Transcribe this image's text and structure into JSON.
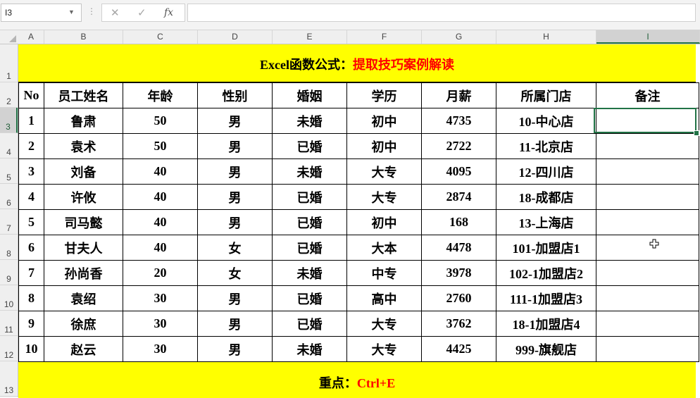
{
  "formula_bar": {
    "name_box": "I3",
    "formula": "",
    "cancel_icon": "✕",
    "enter_icon": "✓",
    "fx_label": "fx"
  },
  "columns": [
    "A",
    "B",
    "C",
    "D",
    "E",
    "F",
    "G",
    "H",
    "I"
  ],
  "selected_column": "I",
  "rows": [
    "1",
    "2",
    "3",
    "4",
    "5",
    "6",
    "7",
    "8",
    "9",
    "10",
    "11",
    "12",
    "13"
  ],
  "selected_row": "3",
  "title": {
    "prefix": "Excel函数公式：",
    "suffix": "提取技巧案例解读"
  },
  "table": {
    "headers": [
      "No",
      "员工姓名",
      "年龄",
      "性别",
      "婚姻",
      "学历",
      "月薪",
      "所属门店",
      "备注"
    ],
    "rows": [
      [
        "1",
        "鲁肃",
        "50",
        "男",
        "未婚",
        "初中",
        "4735",
        "10-中心店",
        ""
      ],
      [
        "2",
        "袁术",
        "50",
        "男",
        "已婚",
        "初中",
        "2722",
        "11-北京店",
        ""
      ],
      [
        "3",
        "刘备",
        "40",
        "男",
        "未婚",
        "大专",
        "4095",
        "12-四川店",
        ""
      ],
      [
        "4",
        "许攸",
        "40",
        "男",
        "已婚",
        "大专",
        "2874",
        "18-成都店",
        ""
      ],
      [
        "5",
        "司马懿",
        "40",
        "男",
        "已婚",
        "初中",
        "168",
        "13-上海店",
        ""
      ],
      [
        "6",
        "甘夫人",
        "40",
        "女",
        "已婚",
        "大本",
        "4478",
        "101-加盟店1",
        ""
      ],
      [
        "7",
        "孙尚香",
        "20",
        "女",
        "未婚",
        "中专",
        "3978",
        "102-1加盟店2",
        ""
      ],
      [
        "8",
        "袁绍",
        "30",
        "男",
        "已婚",
        "高中",
        "2760",
        "111-1加盟店3",
        ""
      ],
      [
        "9",
        "徐庶",
        "30",
        "男",
        "已婚",
        "大专",
        "3762",
        "18-1加盟店4",
        ""
      ],
      [
        "10",
        "赵云",
        "30",
        "男",
        "未婚",
        "大专",
        "4425",
        "999-旗舰店",
        ""
      ]
    ]
  },
  "footer": {
    "prefix": "重点：",
    "suffix": "Ctrl+E"
  },
  "colors": {
    "band": "#ffff00",
    "accent_red": "#ff0000",
    "selection": "#217346"
  },
  "icons": {
    "cursor": "excel-cross-cursor-icon"
  }
}
